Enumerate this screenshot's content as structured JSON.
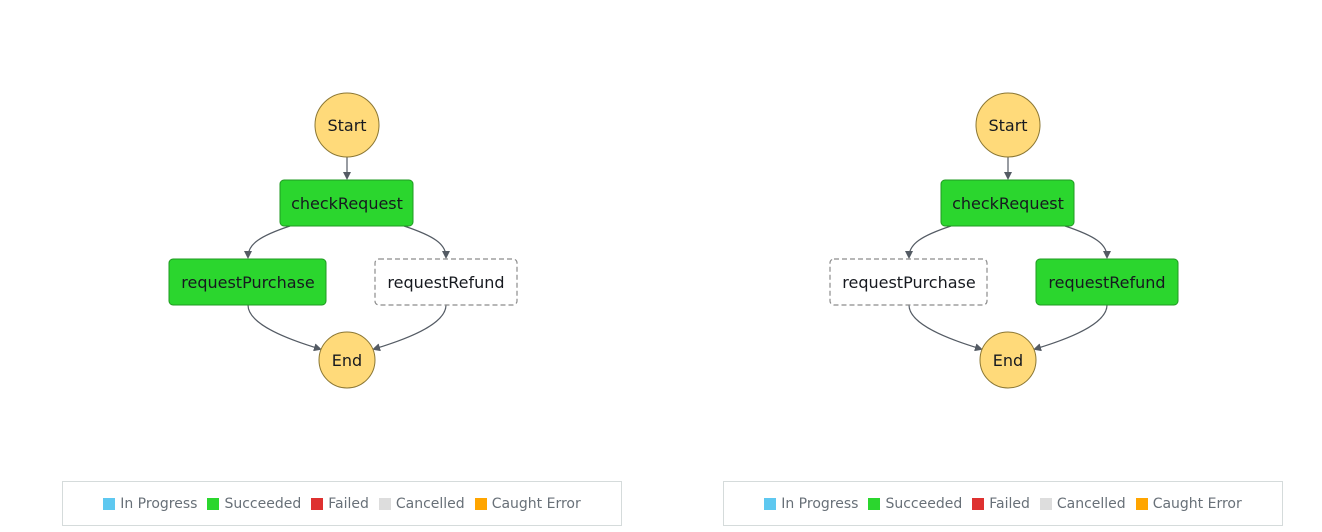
{
  "colors": {
    "terminal_fill": "#ffda7a",
    "terminal_stroke": "#8b7734",
    "succeeded_fill": "#2bd62e",
    "succeeded_stroke": "#1f9a21",
    "not_run_fill": "#ffffff",
    "not_run_stroke": "#8c8c8c",
    "edge": "#545b64",
    "in_progress": "#5ec8f0",
    "failed": "#de3130",
    "cancelled": "#dddddd",
    "caught_error": "#ffa500"
  },
  "legend": {
    "items": [
      {
        "label": "In Progress",
        "color_key": "in_progress"
      },
      {
        "label": "Succeeded",
        "color_key": "succeeded_fill"
      },
      {
        "label": "Failed",
        "color_key": "failed"
      },
      {
        "label": "Cancelled",
        "color_key": "cancelled"
      },
      {
        "label": "Caught Error",
        "color_key": "caught_error"
      }
    ]
  },
  "graphs": [
    {
      "id": "left",
      "start_label": "Start",
      "end_label": "End",
      "check_label": "checkRequest",
      "check_status": "succeeded",
      "purchase_label": "requestPurchase",
      "purchase_status": "succeeded",
      "refund_label": "requestRefund",
      "refund_status": "not-run"
    },
    {
      "id": "right",
      "start_label": "Start",
      "end_label": "End",
      "check_label": "checkRequest",
      "check_status": "succeeded",
      "purchase_label": "requestPurchase",
      "purchase_status": "not-run",
      "refund_label": "requestRefund",
      "refund_status": "succeeded"
    }
  ]
}
